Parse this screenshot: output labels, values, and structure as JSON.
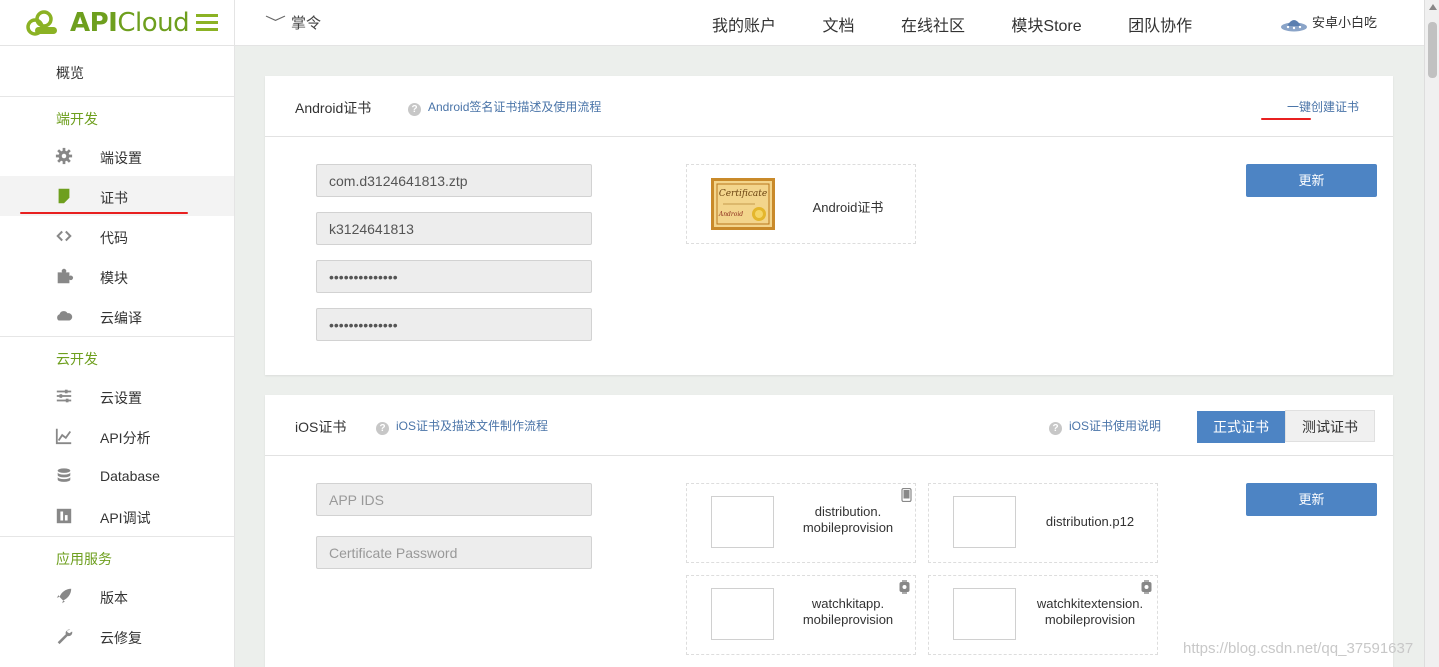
{
  "header": {
    "logo_text_bold": "API",
    "logo_text_rest": "Cloud",
    "app_name": "掌令",
    "nav": [
      "我的账户",
      "文档",
      "在线社区",
      "模块Store",
      "团队协作"
    ],
    "username": "安卓小白吃"
  },
  "sidebar": {
    "overview": "概览",
    "sections": [
      {
        "title": "端开发",
        "items": [
          {
            "label": "端设置",
            "icon": "gear-icon"
          },
          {
            "label": "证书",
            "icon": "certificate-icon",
            "active": true
          },
          {
            "label": "代码",
            "icon": "code-icon"
          },
          {
            "label": "模块",
            "icon": "puzzle-icon"
          },
          {
            "label": "云编译",
            "icon": "cloud-icon"
          }
        ]
      },
      {
        "title": "云开发",
        "items": [
          {
            "label": "云设置",
            "icon": "sliders-icon"
          },
          {
            "label": "API分析",
            "icon": "chart-icon"
          },
          {
            "label": "Database",
            "icon": "database-icon"
          },
          {
            "label": "API调试",
            "icon": "debug-icon"
          }
        ]
      },
      {
        "title": "应用服务",
        "items": [
          {
            "label": "版本",
            "icon": "rocket-icon"
          },
          {
            "label": "云修复",
            "icon": "wrench-icon"
          }
        ]
      }
    ]
  },
  "android": {
    "title": "Android证书",
    "help_link": "Android签名证书描述及使用流程",
    "create_link": "一键创建证书",
    "fields": [
      "com.d3124641813.ztp",
      "k3124641813",
      "••••••••••••••",
      "••••••••••••••"
    ],
    "cert_label": "Android证书",
    "update_button": "更新"
  },
  "ios": {
    "title": "iOS证书",
    "help_link": "iOS证书及描述文件制作流程",
    "usage_link": "iOS证书使用说明",
    "tab_formal": "正式证书",
    "tab_test": "测试证书",
    "placeholders": [
      "APP IDS",
      "Certificate Password"
    ],
    "update_button": "更新",
    "files": [
      {
        "line1": "distribution.",
        "line2": "mobileprovision"
      },
      {
        "line1": "distribution.p12",
        "line2": ""
      },
      {
        "line1": "watchkitapp.",
        "line2": "mobileprovision"
      },
      {
        "line1": "watchkitextension.",
        "line2": "mobileprovision"
      }
    ]
  },
  "watermark": "https://blog.csdn.net/qq_37591637",
  "colors": {
    "brand": "#6e9f1e",
    "primary": "#4d84c4",
    "link": "#4a74a8",
    "annotation": "#e82020"
  }
}
